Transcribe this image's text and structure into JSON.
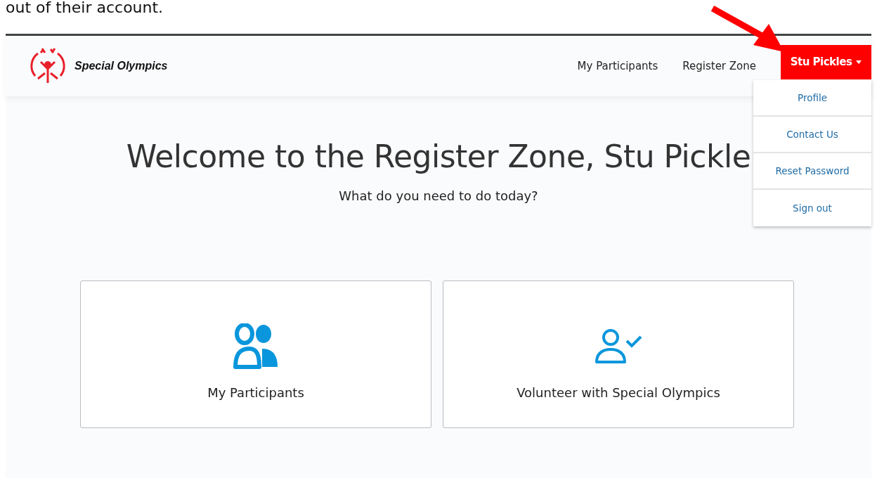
{
  "document_text": "out of their account.",
  "header": {
    "logo_text": "Special Olympics",
    "nav": [
      {
        "label": "My Participants"
      },
      {
        "label": "Register Zone"
      }
    ],
    "user_menu": {
      "label": "Stu Pickles",
      "expanded": true,
      "items": [
        "Profile",
        "Contact Us",
        "Reset Password",
        "Sign out"
      ]
    }
  },
  "heading": "Welcome to the Register Zone, Stu Pickle",
  "subheading": "What do you need to do today?",
  "cards": [
    {
      "kind": "participants",
      "label": "My Participants"
    },
    {
      "kind": "volunteer",
      "label": "Volunteer with Special Olympics"
    }
  ]
}
